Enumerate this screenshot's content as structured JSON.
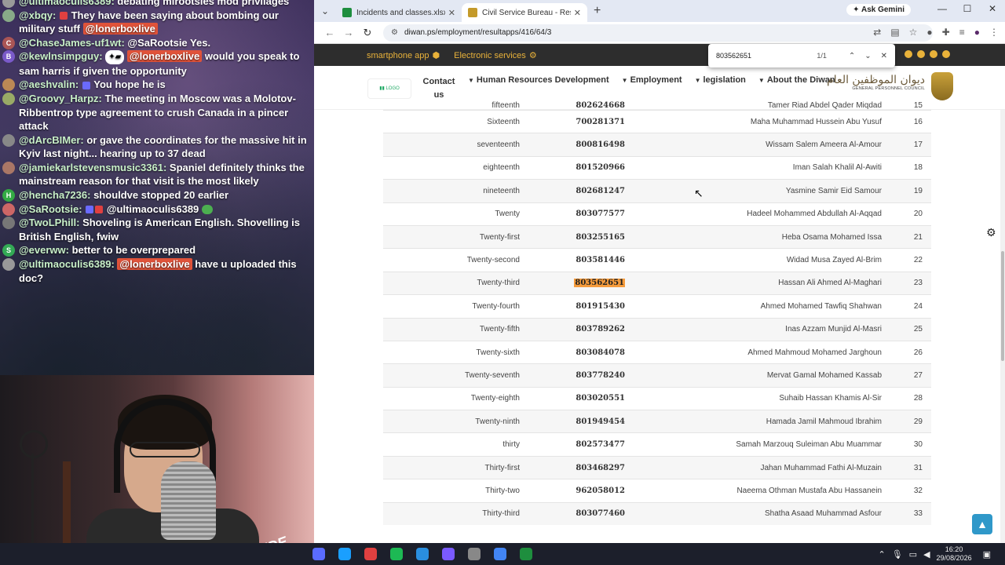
{
  "chat": {
    "messages": [
      {
        "user": "@ultimaoculis6389:",
        "text": "debating mirootsies mod privilages",
        "avatar_color": "#999"
      },
      {
        "user": "@xbqy:",
        "text": "They have been saying about bombing our military stuff",
        "mention": "@lonerboxlive",
        "avatar_color": "#8a8"
      },
      {
        "user": "@ChaseJames-uf1wt:",
        "text": "@SaRootsie Yes.",
        "avatar_color": "#a55",
        "avatar_letter": "C"
      },
      {
        "user": "@kewlnsimpguy:",
        "text": "would you speak to sam harris if given the opportunity",
        "mention": "@lonerboxlive",
        "avatar_color": "#7a5ac9",
        "avatar_letter": "B"
      },
      {
        "user": "@aeshvalin:",
        "text": "You hope he is",
        "avatar_color": "#b85"
      },
      {
        "user": "@Groovy_Harpz:",
        "text": "The meeting in Moscow was a Molotov-Ribbentrop type agreement to crush Canada in a pincer attack",
        "avatar_color": "#9a6"
      },
      {
        "user": "@dArcBIMer:",
        "text": "or gave the coordinates for the massive hit in Kyiv last night... hearing up to 37 dead",
        "avatar_color": "#888"
      },
      {
        "user": "@jamiekarlstevensmusic3361:",
        "text": "Spaniel definitely thinks the mainstream reason for that visit is the most likely",
        "avatar_color": "#a76"
      },
      {
        "user": "@hencha7236:",
        "text": "shouldve stopped 20 earlier",
        "avatar_color": "#3a4",
        "avatar_letter": "H"
      },
      {
        "user": "@SaRootsie:",
        "text": "@ultimaoculis6389",
        "avatar_color": "#c66"
      },
      {
        "user": "@TwoLPhill:",
        "text": "Shoveling is American English. Shovelling is British English, fwiw",
        "avatar_color": "#777"
      },
      {
        "user": "@everww:",
        "text": "better to be overprepared",
        "avatar_color": "#3a5",
        "avatar_letter": "S"
      },
      {
        "user": "@ultimaoculis6389:",
        "text": "have u uploaded this doc?",
        "mention": "@lonerboxlive",
        "avatar_color": "#999"
      }
    ],
    "emote_text": "✦▰"
  },
  "webcam": {
    "mic_brand": "RØDE"
  },
  "browser": {
    "tabs": [
      {
        "title": "Incidents and classes.xlsx - Goo",
        "favicon_color": "#1e8e3e",
        "active": false
      },
      {
        "title": "Civil Service Bureau - Results of",
        "favicon_color": "#c49a2a",
        "active": true
      }
    ],
    "ask_gemini": "Ask Gemini",
    "url": "diwan.ps/employment/resultapps/416/64/3",
    "find": {
      "query": "803562651",
      "count": "1/1"
    }
  },
  "site": {
    "top_links": [
      "smartphone app",
      "Electronic services"
    ],
    "menu": [
      {
        "label": "Contact us",
        "caret": false
      },
      {
        "label": "Human Resources Development",
        "caret": true
      },
      {
        "label": "Employment",
        "caret": true
      },
      {
        "label": "legislation",
        "caret": true
      },
      {
        "label": "About the Diwan",
        "caret": true
      }
    ],
    "council_name_ar": "ديوان الموظفين العام",
    "council_name_en": "GENERAL PERSONNEL COUNCIL"
  },
  "results": {
    "partial_top": {
      "ord": "fifteenth",
      "id": "802624668",
      "name": "Tamer Riad Abdel Qader Miqdad",
      "num": "15"
    },
    "rows": [
      {
        "ord": "Sixteenth",
        "id": "700281371",
        "name": "Maha Muhammad Hussein Abu Yusuf",
        "num": "16"
      },
      {
        "ord": "seventeenth",
        "id": "800816498",
        "name": "Wissam Salem Ameera Al-Amour",
        "num": "17"
      },
      {
        "ord": "eighteenth",
        "id": "801520966",
        "name": "Iman Salah Khalil Al-Awiti",
        "num": "18"
      },
      {
        "ord": "nineteenth",
        "id": "802681247",
        "name": "Yasmine Samir Eid Samour",
        "num": "19"
      },
      {
        "ord": "Twenty",
        "id": "803077577",
        "name": "Hadeel Mohammed Abdullah Al-Aqqad",
        "num": "20"
      },
      {
        "ord": "Twenty-first",
        "id": "803255165",
        "name": "Heba Osama Mohamed Issa",
        "num": "21"
      },
      {
        "ord": "Twenty-second",
        "id": "803581446",
        "name": "Widad Musa Zayed Al-Brim",
        "num": "22"
      },
      {
        "ord": "Twenty-third",
        "id": "803562651",
        "name": "Hassan Ali Ahmed Al-Maghari",
        "num": "23",
        "highlight": true
      },
      {
        "ord": "Twenty-fourth",
        "id": "801915430",
        "name": "Ahmed Mohamed Tawfiq Shahwan",
        "num": "24"
      },
      {
        "ord": "Twenty-fifth",
        "id": "803789262",
        "name": "Inas Azzam Munjid Al-Masri",
        "num": "25"
      },
      {
        "ord": "Twenty-sixth",
        "id": "803084078",
        "name": "Ahmed Mahmoud Mohamed Jarghoun",
        "num": "26"
      },
      {
        "ord": "Twenty-seventh",
        "id": "803778240",
        "name": "Mervat Gamal Mohamed Kassab",
        "num": "27"
      },
      {
        "ord": "Twenty-eighth",
        "id": "803020551",
        "name": "Suhaib Hassan Khamis Al-Sir",
        "num": "28"
      },
      {
        "ord": "Twenty-ninth",
        "id": "801949454",
        "name": "Hamada Jamil Mahmoud Ibrahim",
        "num": "29"
      },
      {
        "ord": "thirty",
        "id": "802573477",
        "name": "Samah Marzouq Suleiman Abu Muammar",
        "num": "30"
      },
      {
        "ord": "Thirty-first",
        "id": "803468297",
        "name": "Jahan Muhammad Fathi Al-Muzain",
        "num": "31"
      },
      {
        "ord": "Thirty-two",
        "id": "962058012",
        "name": "Naeema Othman Mustafa Abu Hassanein",
        "num": "32"
      },
      {
        "ord": "Thirty-third",
        "id": "803077460",
        "name": "Shatha Asaad Muhammad Asfour",
        "num": "33"
      }
    ]
  },
  "taskbar": {
    "time": "16:20",
    "date": "29/08/2026",
    "icons": [
      "#5a6cff",
      "#1a9fff",
      "#e04040",
      "#1db954",
      "#2a8fe0",
      "#7a5aff",
      "#888",
      "#4285f4",
      "#1e8e3e"
    ]
  }
}
